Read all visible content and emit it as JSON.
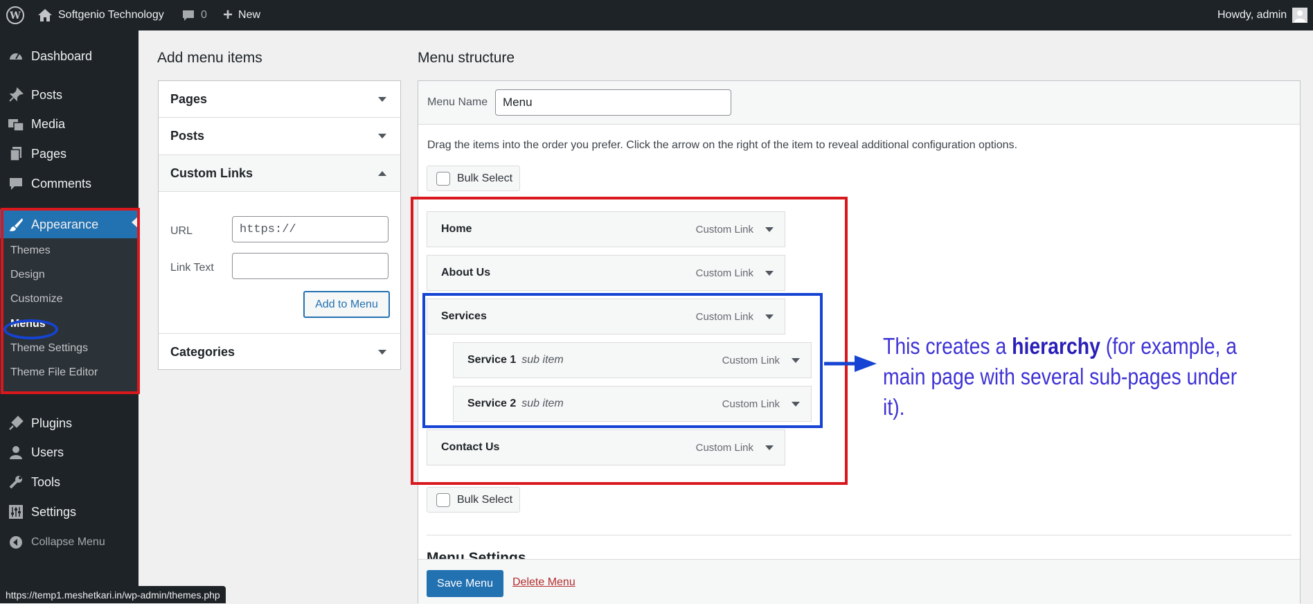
{
  "adminbar": {
    "site_name": "Softgenio Technology",
    "comments_count": "0",
    "new_label": "New",
    "howdy": "Howdy, admin"
  },
  "sidebar": {
    "dashboard": "Dashboard",
    "posts": "Posts",
    "media": "Media",
    "pages": "Pages",
    "comments": "Comments",
    "appearance": "Appearance",
    "sub": {
      "themes": "Themes",
      "design": "Design",
      "customize": "Customize",
      "menus": "Menus",
      "theme_settings": "Theme Settings",
      "theme_file_editor": "Theme File Editor"
    },
    "plugins": "Plugins",
    "users": "Users",
    "tools": "Tools",
    "settings": "Settings",
    "collapse": "Collapse Menu"
  },
  "add_items": {
    "heading": "Add menu items",
    "pages": "Pages",
    "posts": "Posts",
    "custom_links": "Custom Links",
    "url_label": "URL",
    "url_placeholder": "https://",
    "link_text_label": "Link Text",
    "add_button": "Add to Menu",
    "categories": "Categories"
  },
  "structure": {
    "heading": "Menu structure",
    "menu_name_label": "Menu Name",
    "menu_name_value": "Menu",
    "instructions": "Drag the items into the order you prefer. Click the arrow on the right of the item to reveal additional configuration options.",
    "bulk_select": "Bulk Select",
    "items": [
      {
        "title": "Home",
        "sub": "",
        "type": "Custom Link"
      },
      {
        "title": "About Us",
        "sub": "",
        "type": "Custom Link"
      },
      {
        "title": "Services",
        "sub": "",
        "type": "Custom Link"
      },
      {
        "title": "Service 1",
        "sub": "sub item",
        "type": "Custom Link"
      },
      {
        "title": "Service 2",
        "sub": "sub item",
        "type": "Custom Link"
      },
      {
        "title": "Contact Us",
        "sub": "",
        "type": "Custom Link"
      }
    ],
    "menu_settings": "Menu Settings",
    "save_button": "Save Menu",
    "delete_link": "Delete Menu"
  },
  "status_url": "https://temp1.meshetkari.in/wp-admin/themes.php",
  "annotation": {
    "part1": "This creates a ",
    "bold": "hierarchy",
    "part2": " (for example, a main page with several sub-pages under it)."
  },
  "colors": {
    "adminbar": "#1d2327",
    "accent": "#2271b1",
    "highlight_red": "#d9181e",
    "highlight_blue": "#1543d3",
    "annotation": "#3e32d5"
  }
}
